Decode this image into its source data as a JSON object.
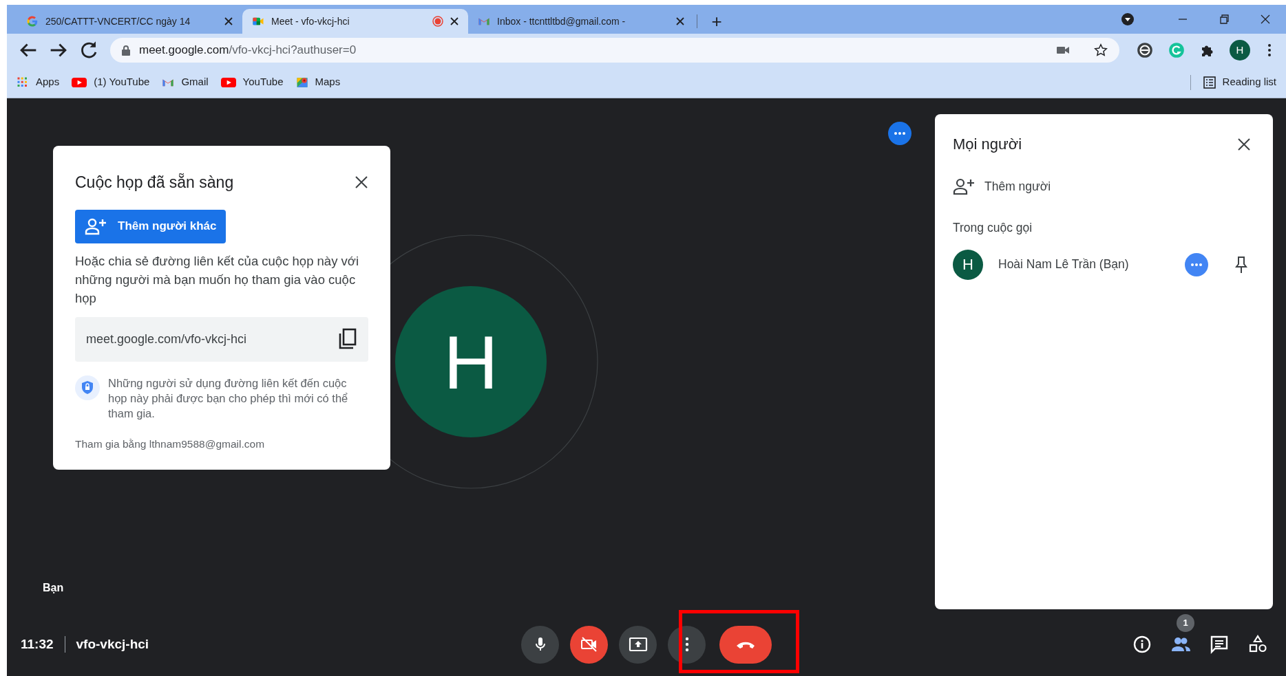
{
  "browser": {
    "tabs": [
      {
        "title": "250/CATTT-VNCERT/CC ngày 14",
        "kind": "google",
        "selected": false,
        "recording": false
      },
      {
        "title": "Meet - vfo-vkcj-hci",
        "kind": "meet",
        "selected": true,
        "recording": true
      },
      {
        "title": "Inbox - ttcnttltbd@gmail.com -",
        "kind": "gmail",
        "selected": false,
        "recording": false
      }
    ],
    "new_tab": "+",
    "address": {
      "host": "meet.google.com",
      "path": "/vfo-vkcj-hci?authuser=0"
    },
    "profile_initial": "H",
    "bookmarks": [
      {
        "label": "Apps",
        "kind": "apps"
      },
      {
        "label": "(1) YouTube",
        "kind": "youtube"
      },
      {
        "label": "Gmail",
        "kind": "gmail"
      },
      {
        "label": "YouTube",
        "kind": "youtube"
      },
      {
        "label": "Maps",
        "kind": "maps"
      }
    ],
    "reading_list": "Reading list"
  },
  "ready_card": {
    "title": "Cuộc họp đã sẵn sàng",
    "add_button": "Thêm người khác",
    "description": "Hoặc chia sẻ đường liên kết của cuộc họp này với những người mà bạn muốn họ tham gia vào cuộc họp",
    "link": "meet.google.com/vfo-vkcj-hci",
    "notice": "Những người sử dụng đường liên kết đến cuộc họp này phải được bạn cho phép thì mới có thể tham gia.",
    "joined_as": "Tham gia bằng lthnam9588@gmail.com"
  },
  "stage": {
    "avatar_initial": "H",
    "self_label": "Bạn"
  },
  "people_panel": {
    "title": "Mọi người",
    "add_people": "Thêm người",
    "section": "Trong cuộc gọi",
    "participants": [
      {
        "initial": "H",
        "name": "Hoài Nam Lê Trần (Bạn)"
      }
    ]
  },
  "bottom_bar": {
    "time": "11:32",
    "meeting_code": "vfo-vkcj-hci",
    "controls": [
      {
        "kind": "mic",
        "off": false
      },
      {
        "kind": "camera",
        "off": true
      },
      {
        "kind": "present",
        "off": false
      },
      {
        "kind": "more",
        "off": false
      },
      {
        "kind": "leave"
      }
    ],
    "side_buttons": [
      {
        "kind": "info",
        "selected": false
      },
      {
        "kind": "people",
        "selected": true,
        "badge": "1"
      },
      {
        "kind": "chat",
        "selected": false
      },
      {
        "kind": "activities",
        "selected": false
      }
    ]
  }
}
